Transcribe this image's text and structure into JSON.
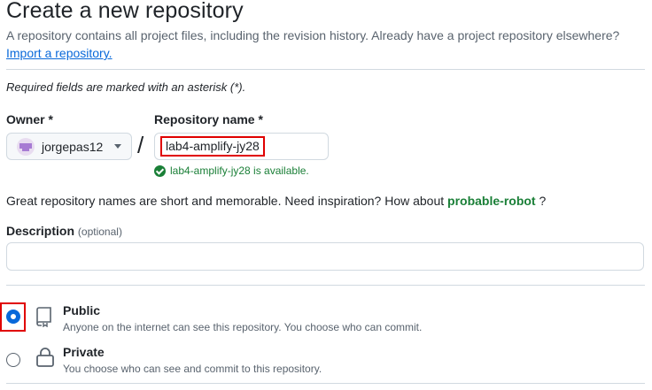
{
  "header": {
    "title": "Create a new repository",
    "subtitle": "A repository contains all project files, including the revision history. Already have a project repository elsewhere?",
    "import_link": "Import a repository."
  },
  "required_note": "Required fields are marked with an asterisk (*).",
  "owner": {
    "label": "Owner *",
    "value": "jorgepas12"
  },
  "separator": "/",
  "repository_name": {
    "label": "Repository name *",
    "value": "lab4-amplify-jy28",
    "availability": "lab4-amplify-jy28 is available."
  },
  "inspiration": {
    "text": "Great repository names are short and memorable. Need inspiration? How about",
    "suggestion": "probable-robot",
    "suffix": "?"
  },
  "description": {
    "label": "Description",
    "optional": "(optional)",
    "value": ""
  },
  "visibility": [
    {
      "title": "Public",
      "description": "Anyone on the internet can see this repository. You choose who can commit.",
      "selected": true,
      "icon": "repo-book-icon"
    },
    {
      "title": "Private",
      "description": "You choose who can see and commit to this repository.",
      "selected": false,
      "icon": "lock-icon"
    }
  ],
  "colors": {
    "accent": "#0969da",
    "success": "#1a7f37",
    "highlight": "#e00000"
  }
}
